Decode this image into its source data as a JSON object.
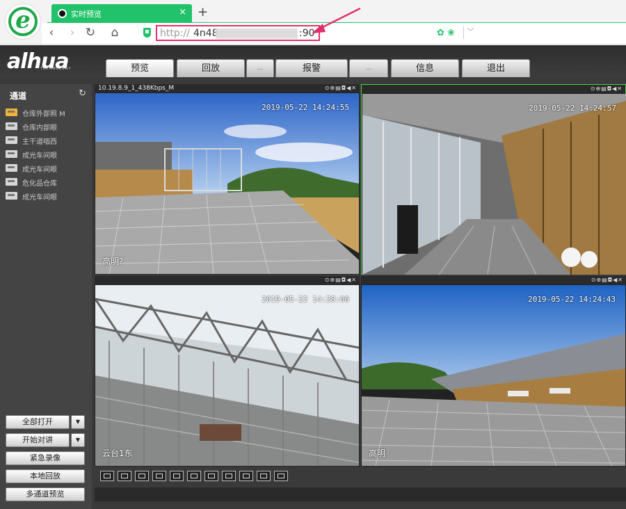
{
  "browser": {
    "tab_title": "实时预览",
    "new_tab": "+",
    "close": "×",
    "nav": {
      "back": "‹",
      "forward": "›",
      "reload": "↻",
      "home": "⌂"
    },
    "url": {
      "scheme": "http://",
      "host": "4n48",
      "port": ":90"
    },
    "ext_icons": "✿ ❀",
    "dropdown": "﹀"
  },
  "app": {
    "brand": "alhua",
    "brand_sub": "TECHNOLOGY",
    "tabs": [
      {
        "label": "预览"
      },
      {
        "label": "回放"
      },
      {
        "label": "..."
      },
      {
        "label": "报警"
      },
      {
        "label": "..."
      },
      {
        "label": "信息"
      },
      {
        "label": "退出"
      }
    ],
    "sidebar": {
      "title": "通道",
      "channels": [
        {
          "label": "仓库外部照  M"
        },
        {
          "label": "仓库内部眼"
        },
        {
          "label": "主干道咽西"
        },
        {
          "label": "成光车间眼"
        },
        {
          "label": "成光车间眼"
        },
        {
          "label": "危化品仓库"
        },
        {
          "label": "成光车间眼"
        }
      ],
      "buttons": {
        "open_all": "全部打开",
        "talk": "开始对讲",
        "emergency_record": "紧急录像",
        "local_playback": "本地回放",
        "multi_preview": "多通道预览"
      }
    },
    "panes": [
      {
        "label": "10.19.8.9_1_438Kbps_M",
        "time": "2019-05-22 14:24:55",
        "name": "高明?"
      },
      {
        "label": "",
        "time": "2019-05-22 14:24:57",
        "name": ""
      },
      {
        "label": "",
        "time": "2019-05-22 14:28:00",
        "name": "云台1东"
      },
      {
        "label": "",
        "time": "2019-05-22 14:24:43",
        "name": "高明"
      }
    ],
    "pane_icons": "⊙⊕▤◘◀✕"
  },
  "colors": {
    "accent_green": "#22c26b",
    "annotation": "#e0306a",
    "active_pane_border": "#4fd34f"
  }
}
